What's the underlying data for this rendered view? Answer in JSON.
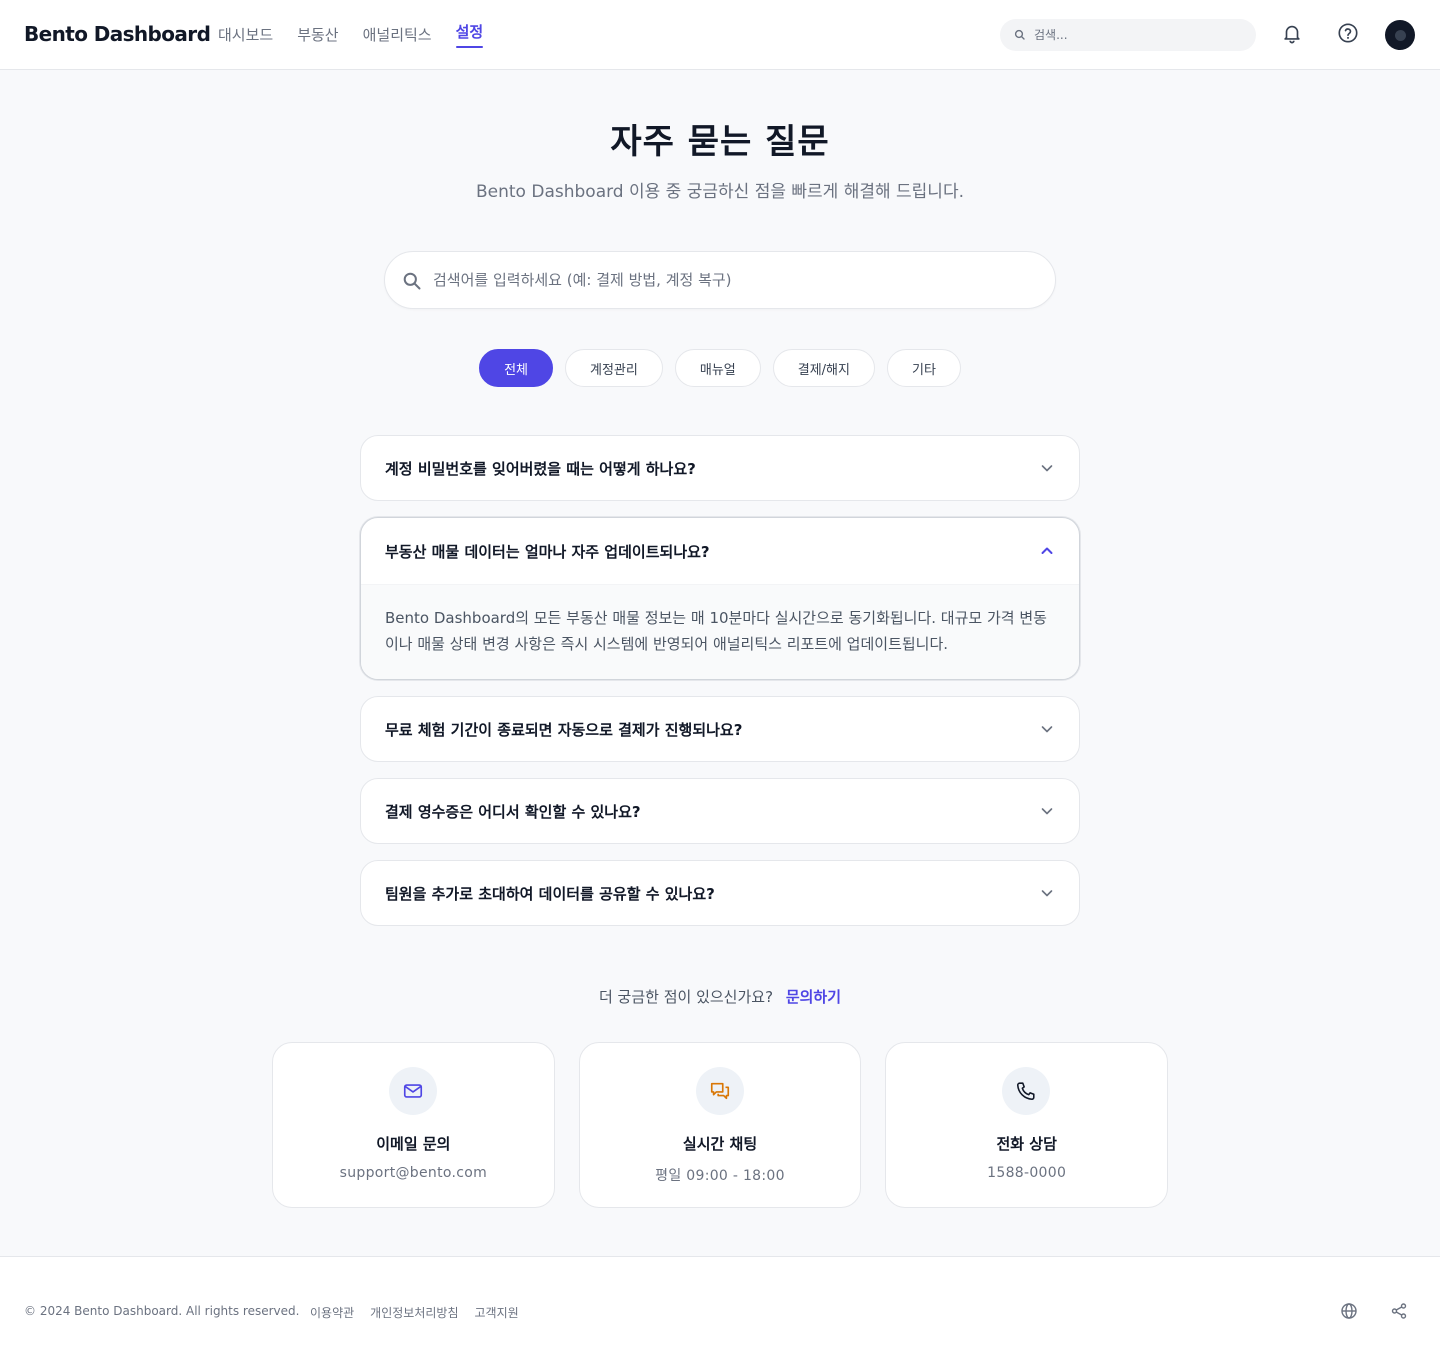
{
  "header": {
    "logo": "Bento Dashboard",
    "nav": [
      {
        "label": "대시보드",
        "active": false
      },
      {
        "label": "부동산",
        "active": false
      },
      {
        "label": "애널리틱스",
        "active": false
      },
      {
        "label": "설정",
        "active": true
      }
    ],
    "search_placeholder": "검색...",
    "icons": [
      "search-icon",
      "bell-icon",
      "help-icon",
      "avatar"
    ]
  },
  "hero": {
    "title": "자주 묻는 질문",
    "subtitle": "Bento Dashboard 이용 중 궁금하신 점을 빠르게 해결해 드립니다.",
    "search_placeholder": "검색어를 입력하세요 (예: 결제 방법, 계정 복구)"
  },
  "categories": [
    {
      "label": "전체",
      "active": true
    },
    {
      "label": "계정관리",
      "active": false
    },
    {
      "label": "매뉴얼",
      "active": false
    },
    {
      "label": "결제/해지",
      "active": false
    },
    {
      "label": "기타",
      "active": false
    }
  ],
  "faqs": [
    {
      "question": "계정 비밀번호를 잊어버렸을 때는 어떻게 하나요?",
      "open": false
    },
    {
      "question": "부동산 매물 데이터는 얼마나 자주 업데이트되나요?",
      "open": true,
      "answer": "Bento Dashboard의 모든 부동산 매물 정보는 매 10분마다 실시간으로 동기화됩니다. 대규모 가격 변동이나 매물 상태 변경 사항은 즉시 시스템에 반영되어 애널리틱스 리포트에 업데이트됩니다."
    },
    {
      "question": "무료 체험 기간이 종료되면 자동으로 결제가 진행되나요?",
      "open": false
    },
    {
      "question": "결제 영수증은 어디서 확인할 수 있나요?",
      "open": false
    },
    {
      "question": "팀원을 추가로 초대하여 데이터를 공유할 수 있나요?",
      "open": false
    }
  ],
  "contact": {
    "prompt": "더 궁금한 점이 있으신가요?",
    "link": "문의하기",
    "cards": [
      {
        "title": "이메일 문의",
        "value": "support@bento.com",
        "icon": "mail-icon",
        "color": "#4f46e5"
      },
      {
        "title": "실시간 채팅",
        "value": "평일 09:00 - 18:00",
        "icon": "chat-icon",
        "color": "#d97706"
      },
      {
        "title": "전화 상담",
        "value": "1588-0000",
        "icon": "phone-icon",
        "color": "#111827"
      }
    ]
  },
  "footer": {
    "copyright": "© 2024 Bento Dashboard. All rights reserved.",
    "links": [
      "이용약관",
      "개인정보처리방침",
      "고객지원"
    ],
    "icons": [
      "globe-icon",
      "share-icon"
    ]
  },
  "colors": {
    "accent": "#4f46e5",
    "background": "#f8f9fb",
    "text": "#111827",
    "muted": "#6b7280"
  }
}
